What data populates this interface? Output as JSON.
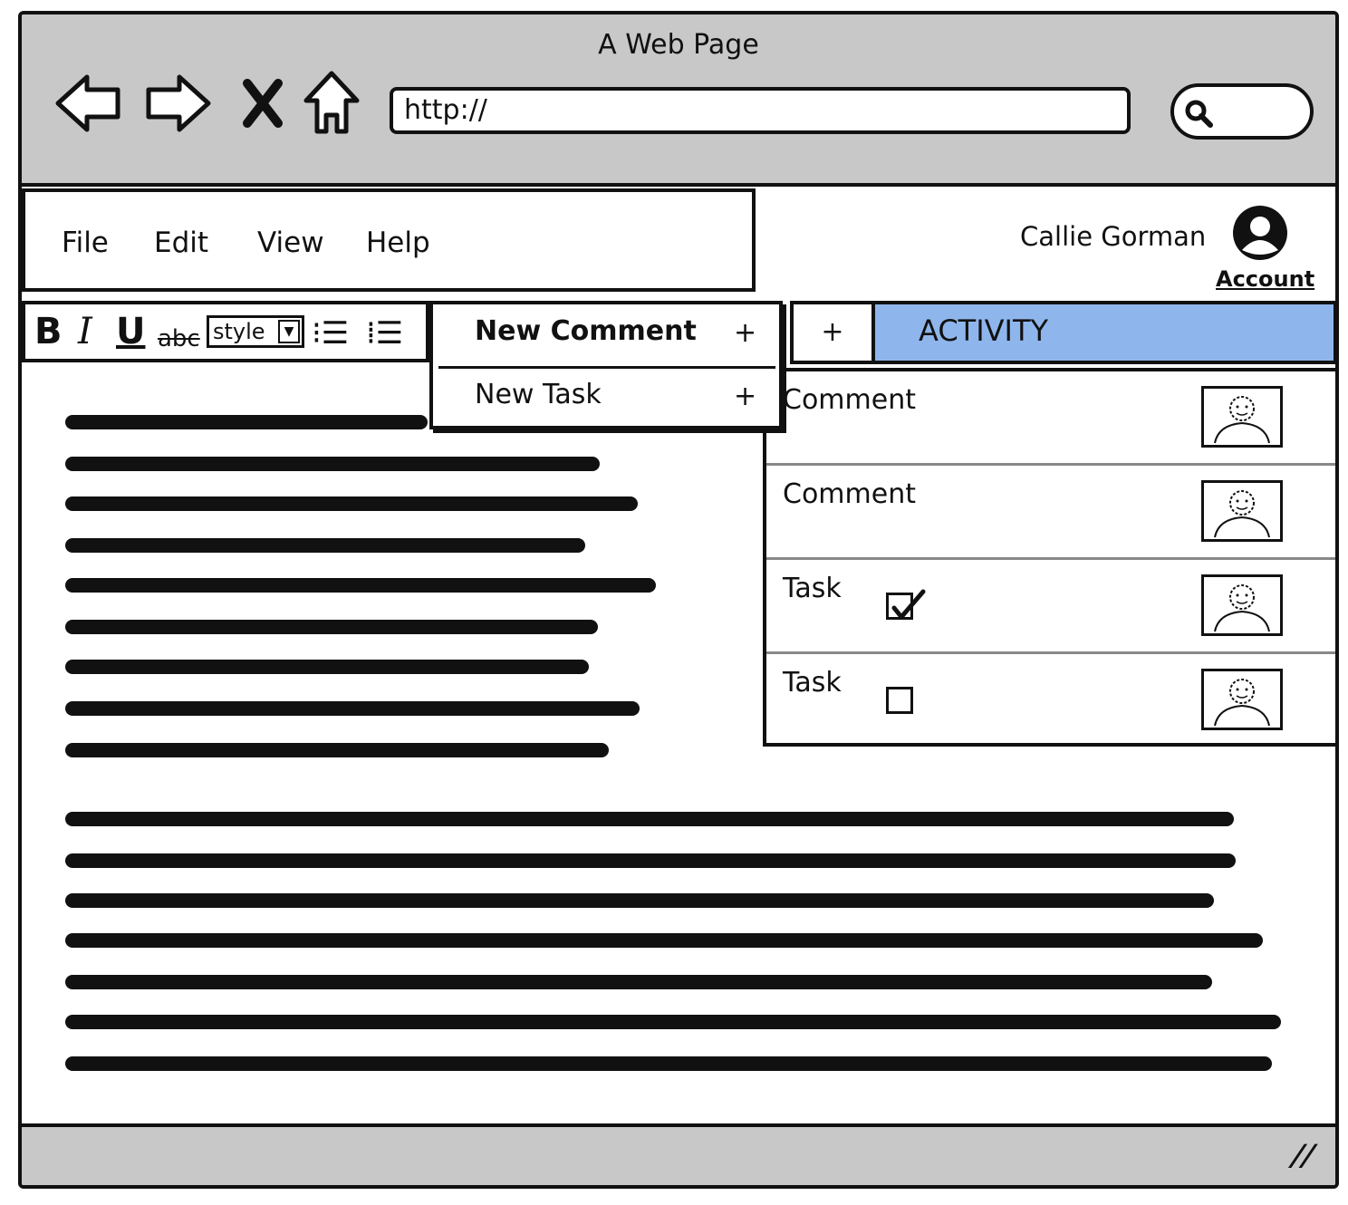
{
  "window": {
    "title": "A Web Page"
  },
  "browser": {
    "nav": [
      {
        "name": "back-icon"
      },
      {
        "name": "forward-icon"
      },
      {
        "name": "stop-icon"
      },
      {
        "name": "home-icon"
      }
    ],
    "url": "http://",
    "search_icon": "search-icon"
  },
  "menubar": {
    "items": [
      "File",
      "Edit",
      "View",
      "Help"
    ]
  },
  "user": {
    "name": "Callie Gorman",
    "account_link": "Account",
    "avatar_icon": "user-avatar-icon"
  },
  "toolbar": {
    "bold": "B",
    "italic": "I",
    "underline": "U",
    "strike": "abc",
    "style_label": "style",
    "style_dropdown": "▼",
    "bullet_list": "⁝☰",
    "numbered_list": "⁞☰"
  },
  "dropdown": {
    "items": [
      {
        "label": "New Comment",
        "plus": "+"
      },
      {
        "label": "New Task",
        "plus": "+"
      }
    ]
  },
  "activity": {
    "add_label": "+",
    "title": "ACTIVITY",
    "header_color": "#8fb6ec",
    "rows": [
      {
        "label": "Comment",
        "type": "comment"
      },
      {
        "label": "Comment",
        "type": "comment"
      },
      {
        "label": "Task",
        "type": "task",
        "checked": true
      },
      {
        "label": "Task",
        "type": "task",
        "checked": false
      }
    ]
  },
  "statusbar": {
    "grip": "//"
  }
}
